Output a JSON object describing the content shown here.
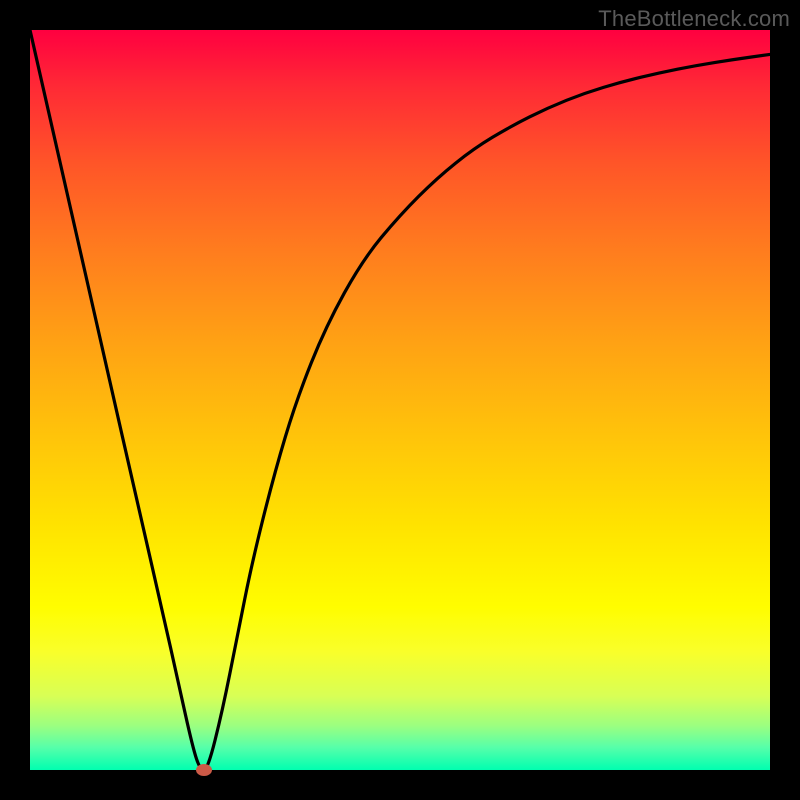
{
  "watermark": "TheBottleneck.com",
  "colors": {
    "frame": "#000000",
    "curve": "#000000",
    "marker": "#cc5a47",
    "gradient_top": "#ff0040",
    "gradient_bottom": "#00ffb0"
  },
  "chart_data": {
    "type": "line",
    "title": "",
    "xlabel": "",
    "ylabel": "",
    "xlim": [
      0,
      100
    ],
    "ylim": [
      0,
      100
    ],
    "grid": false,
    "legend": false,
    "annotations": [
      "TheBottleneck.com"
    ],
    "series": [
      {
        "name": "curve",
        "x": [
          0,
          5,
          10,
          15,
          18,
          20,
          22,
          23,
          24,
          26,
          28,
          30,
          33,
          36,
          40,
          45,
          50,
          55,
          60,
          65,
          70,
          75,
          80,
          85,
          90,
          95,
          100
        ],
        "y": [
          100,
          78,
          56,
          34,
          21,
          12,
          3,
          0,
          0,
          8,
          18,
          28,
          40,
          50,
          60,
          69,
          75,
          80,
          84,
          87,
          89.5,
          91.5,
          93,
          94.2,
          95.2,
          96,
          96.7
        ]
      }
    ],
    "marker": {
      "x": 23.5,
      "y": 0
    }
  }
}
